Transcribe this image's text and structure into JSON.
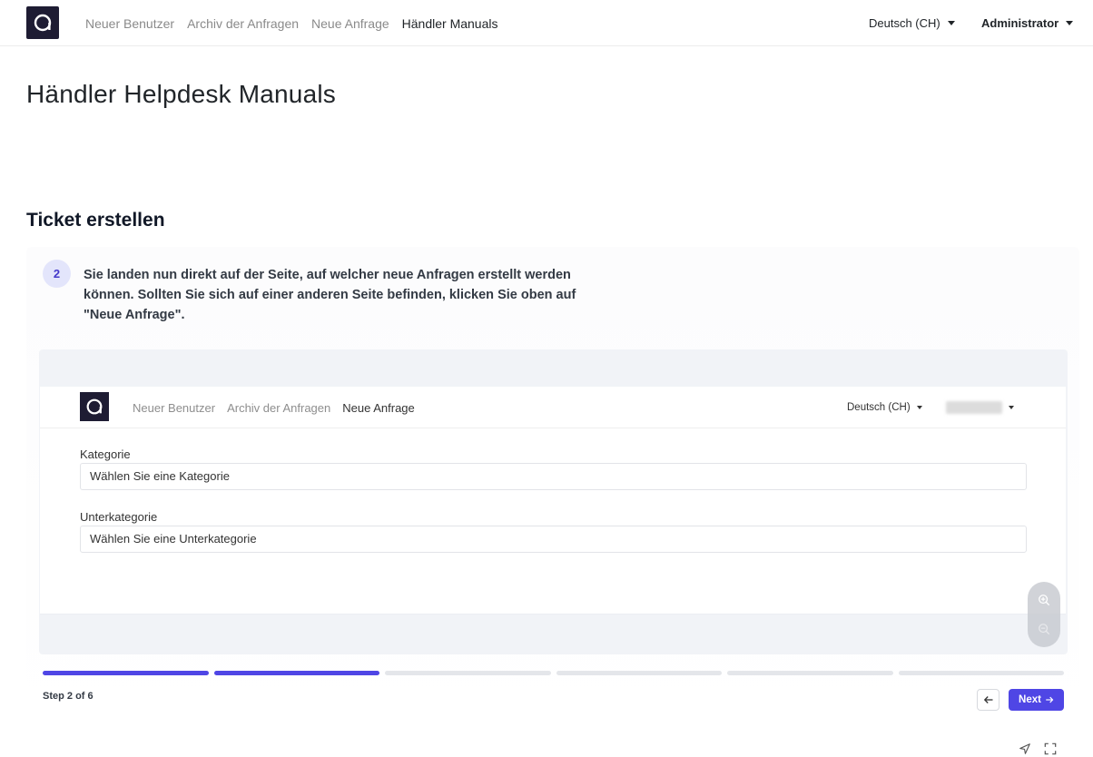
{
  "topbar": {
    "nav": [
      "Neuer Benutzer",
      "Archiv der Anfragen",
      "Neue Anfrage",
      "Händler Manuals"
    ],
    "active_index": 3,
    "language": "Deutsch (CH)",
    "user": "Administrator"
  },
  "page": {
    "title": "Händler Helpdesk Manuals",
    "section_title": "Ticket erstellen"
  },
  "guide": {
    "step_number": "2",
    "step_text": "Sie landen nun direkt auf der Seite, auf welcher neue Anfragen erstellt werden können. Sollten Sie sich auf einer anderen Seite befinden, klicken Sie oben auf \"Neue Anfrage\".",
    "step_label": "Step 2 of 6",
    "current_step": 2,
    "total_steps": 6,
    "next_label": "Next"
  },
  "screenshot": {
    "nav": [
      "Neuer Benutzer",
      "Archiv der Anfragen",
      "Neue Anfrage"
    ],
    "language": "Deutsch (CH)",
    "category_label": "Kategorie",
    "category_placeholder": "Wählen Sie eine Kategorie",
    "subcategory_label": "Unterkategorie",
    "subcategory_placeholder": "Wählen Sie eine Unterkategorie"
  },
  "colors": {
    "accent": "#4f46e5",
    "logo_bg": "#1e1c33"
  }
}
